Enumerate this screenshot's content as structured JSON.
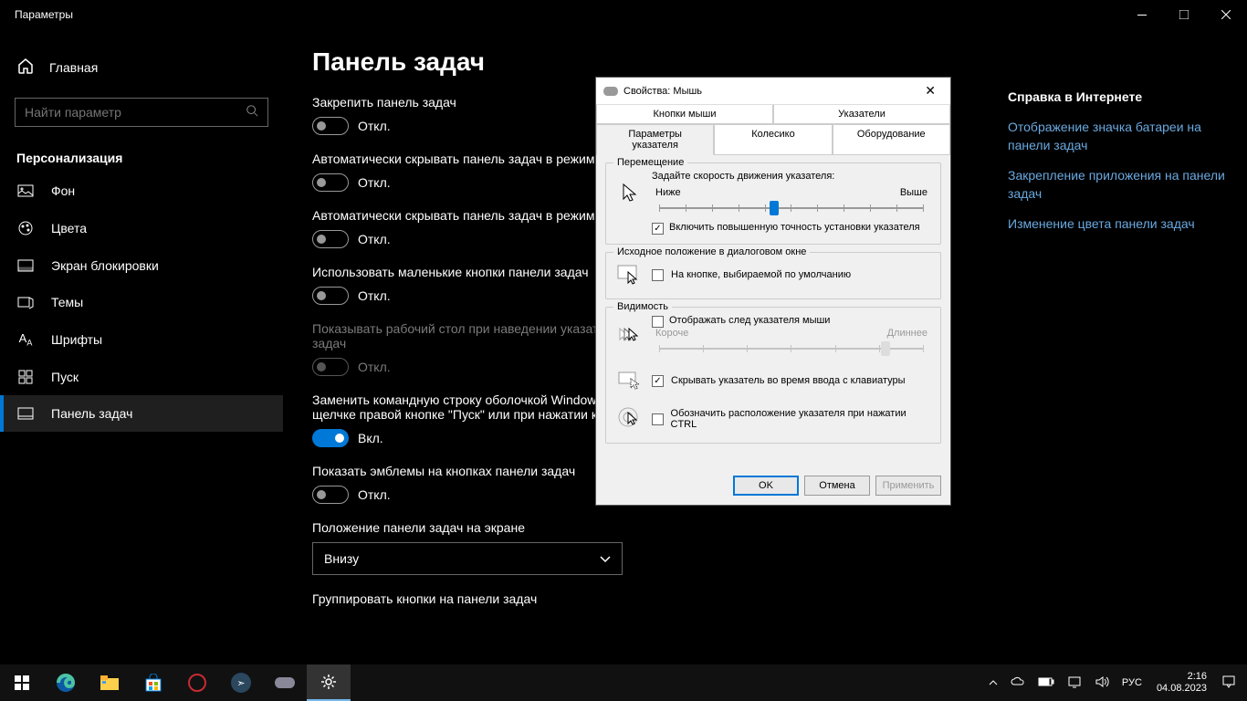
{
  "window": {
    "title": "Параметры"
  },
  "sidebar": {
    "home": "Главная",
    "search_placeholder": "Найти параметр",
    "section": "Персонализация",
    "items": [
      {
        "label": "Фон"
      },
      {
        "label": "Цвета"
      },
      {
        "label": "Экран блокировки"
      },
      {
        "label": "Темы"
      },
      {
        "label": "Шрифты"
      },
      {
        "label": "Пуск"
      },
      {
        "label": "Панель задач"
      }
    ]
  },
  "content": {
    "title": "Панель задач",
    "settings": [
      {
        "label": "Закрепить панель задач",
        "state": "Откл."
      },
      {
        "label": "Автоматически скрывать панель задач в режим",
        "state": "Откл."
      },
      {
        "label": "Автоматически скрывать панель задач в режим",
        "state": "Откл."
      },
      {
        "label": "Использовать маленькие кнопки панели задач",
        "state": "Откл."
      },
      {
        "label": "Показывать рабочий стол при наведении указате \"Свернуть все окна\" в конце панели задач",
        "state": "Откл.",
        "disabled": true
      },
      {
        "label": "Заменить командную строку оболочкой Windows меню, которое появляется при щелчке правой кнопке \"Пуск\" или при нажатии клавиш Windo",
        "state": "Вкл.",
        "on": true
      },
      {
        "label": "Показать эмблемы на кнопках панели задач",
        "state": "Откл."
      }
    ],
    "position_label": "Положение панели задач на экране",
    "position_value": "Внизу",
    "group_label": "Группировать кнопки на панели задач"
  },
  "help": {
    "title": "Справка в Интернете",
    "links": [
      "Отображение значка батареи на панели задач",
      "Закрепление приложения на панели задач",
      "Изменение цвета панели задач"
    ]
  },
  "dialog": {
    "title": "Свойства: Мышь",
    "tabs_row1": [
      "Кнопки мыши",
      "Указатели"
    ],
    "tabs_row2": [
      "Параметры указателя",
      "Колесико",
      "Оборудование"
    ],
    "move_group": "Перемещение",
    "speed_label": "Задайте скорость движения указателя:",
    "slow": "Ниже",
    "fast": "Выше",
    "precision": "Включить повышенную точность установки указателя",
    "home_group": "Исходное положение в диалоговом окне",
    "home_check": "На кнопке, выбираемой по умолчанию",
    "vis_group": "Видимость",
    "trail": "Отображать след указателя мыши",
    "trail_short": "Короче",
    "trail_long": "Длиннее",
    "hide_typing": "Скрывать указатель во время ввода с клавиатуры",
    "ctrl_locate": "Обозначить расположение указателя при нажатии CTRL",
    "ok": "OK",
    "cancel": "Отмена",
    "apply": "Применить"
  },
  "tray": {
    "lang": "РУС",
    "time": "2:16",
    "date": "04.08.2023"
  }
}
